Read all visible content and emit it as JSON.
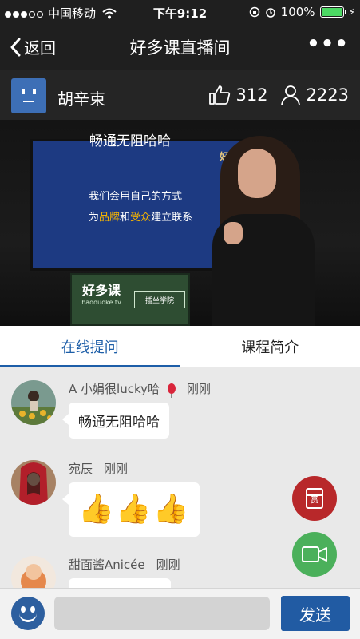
{
  "status_bar": {
    "carrier": "中国移动",
    "time": "下午9:12",
    "battery": "100%",
    "battery_level": 1.0
  },
  "navbar": {
    "back_label": "返回",
    "title": "好多课直播间",
    "more_label": "•••"
  },
  "host": {
    "name": "胡辛束",
    "likes": "312",
    "viewers": "2223"
  },
  "video": {
    "overlay_text": "畅通无阻哈哈",
    "screen_line1": "我们会用自己的方式",
    "screen_line2_parts": [
      "为",
      "品牌",
      "和",
      "受众",
      "建立联系"
    ],
    "screen_corner": "好多",
    "stand_logo": "好多课",
    "stand_url": "haoduoke.tv",
    "stand_tag": "插坐学院"
  },
  "tabs": [
    {
      "label": "在线提问",
      "active": true
    },
    {
      "label": "课程简介",
      "active": false
    }
  ],
  "messages": [
    {
      "user": "A 小娟很lucky哈",
      "time": "刚刚",
      "text": "畅通无阻哈哈",
      "has_balloon": true
    },
    {
      "user": "宛辰",
      "time": "刚刚",
      "thumbs": [
        "👍",
        "👍",
        "👍"
      ]
    },
    {
      "user": "甜面酱Anicée",
      "time": "刚刚",
      "text": ""
    }
  ],
  "fab": {
    "reward_label": "赏"
  },
  "input": {
    "placeholder": "",
    "send_label": "发送"
  },
  "colors": {
    "accent": "#1d5ea8",
    "reward": "#b8282a",
    "video": "#4bb05b",
    "header_bg": "#1f1f1f"
  },
  "icons": [
    "back-chevron-icon",
    "more-icon",
    "thumb-up-icon",
    "user-icon",
    "reward-icon",
    "video-camera-icon",
    "smiley-icon",
    "wifi-icon",
    "battery-icon",
    "balloon-icon"
  ]
}
